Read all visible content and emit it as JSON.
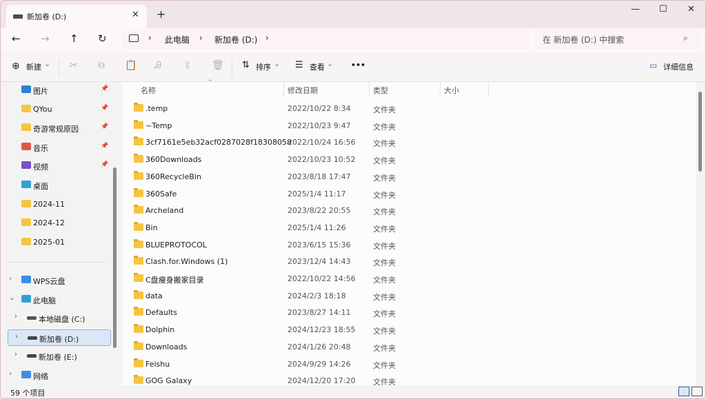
{
  "tab": {
    "title": "新加卷 (D:)",
    "close": "✕",
    "new_tab": "+"
  },
  "window_controls": {
    "minimize": "—",
    "maximize": "☐",
    "close": "✕"
  },
  "nav": {
    "back": "←",
    "forward": "→",
    "up": "↑",
    "refresh": "↻"
  },
  "address": {
    "separator": "›",
    "crumbs": [
      "此电脑",
      "新加卷 (D:)"
    ]
  },
  "search": {
    "placeholder": "在 新加卷 (D:) 中搜索",
    "icon": "⌕"
  },
  "toolbar": {
    "new_label": "新建",
    "new_icon": "⊕",
    "cut_icon": "✂",
    "copy_icon": "⧉",
    "paste_icon": "📋",
    "rename_icon": "Ꭿ",
    "share_icon": "⇪",
    "delete_icon": "🗑",
    "sort_label": "排序",
    "view_label": "查看",
    "more": "•••",
    "details_label": "详细信息",
    "caret": "⌄"
  },
  "sidebar": {
    "pin": "📌",
    "quick_access": [
      {
        "label": "图片",
        "icon": "pictures-icon",
        "color": "#2f7fd6",
        "pinned": true
      },
      {
        "label": "QYou",
        "icon": "folder-icon",
        "color": "#f5c542",
        "pinned": true
      },
      {
        "label": "奇游常规原因",
        "icon": "folder-icon",
        "color": "#f5c542",
        "pinned": true
      },
      {
        "label": "音乐",
        "icon": "music-icon",
        "color": "#e2574c",
        "pinned": true
      },
      {
        "label": "视频",
        "icon": "video-icon",
        "color": "#7b4fc9",
        "pinned": true
      },
      {
        "label": "桌面",
        "icon": "desktop-icon",
        "color": "#2fa0d6",
        "pinned": false
      },
      {
        "label": "2024-11",
        "icon": "folder-icon",
        "color": "#f5c542",
        "pinned": false
      },
      {
        "label": "2024-12",
        "icon": "folder-icon",
        "color": "#f5c542",
        "pinned": false
      },
      {
        "label": "2025-01",
        "icon": "folder-icon",
        "color": "#f5c542",
        "pinned": false
      }
    ],
    "tree": [
      {
        "label": "WPS云盘",
        "icon": "cloud-icon",
        "chevron": "›",
        "indent": 0
      },
      {
        "label": "此电脑",
        "icon": "computer-icon",
        "chevron": "⌄",
        "indent": 0
      },
      {
        "label": "本地磁盘 (C:)",
        "icon": "drive-c-icon",
        "chevron": "›",
        "indent": 1
      },
      {
        "label": "新加卷 (D:)",
        "icon": "drive-icon",
        "chevron": "›",
        "indent": 1,
        "selected": true
      },
      {
        "label": "新加卷 (E:)",
        "icon": "drive-icon",
        "chevron": "›",
        "indent": 1
      },
      {
        "label": "网络",
        "icon": "network-icon",
        "chevron": "›",
        "indent": 0
      }
    ]
  },
  "columns": {
    "name": "名称",
    "modified": "修改日期",
    "type": "类型",
    "size": "大小",
    "sort_indicator": "⌃"
  },
  "files": [
    {
      "name": ".temp",
      "modified": "2022/10/22 8:34",
      "type": "文件夹"
    },
    {
      "name": "~Temp",
      "modified": "2022/10/23 9:47",
      "type": "文件夹"
    },
    {
      "name": "3cf7161e5eb32acf0287028f18308058",
      "modified": "2022/10/24 16:56",
      "type": "文件夹"
    },
    {
      "name": "360Downloads",
      "modified": "2022/10/23 10:52",
      "type": "文件夹"
    },
    {
      "name": "360RecycleBin",
      "modified": "2023/8/18 17:47",
      "type": "文件夹"
    },
    {
      "name": "360Safe",
      "modified": "2025/1/4 11:17",
      "type": "文件夹"
    },
    {
      "name": "Archeland",
      "modified": "2023/8/22 20:55",
      "type": "文件夹"
    },
    {
      "name": "Bin",
      "modified": "2025/1/4 11:26",
      "type": "文件夹"
    },
    {
      "name": "BLUEPROTOCOL",
      "modified": "2023/6/15 15:36",
      "type": "文件夹"
    },
    {
      "name": "Clash.for.Windows (1)",
      "modified": "2023/12/4 14:43",
      "type": "文件夹"
    },
    {
      "name": "C盘瘦身搬家目录",
      "modified": "2022/10/22 14:56",
      "type": "文件夹"
    },
    {
      "name": "data",
      "modified": "2024/2/3 18:18",
      "type": "文件夹"
    },
    {
      "name": "Defaults",
      "modified": "2023/8/27 14:11",
      "type": "文件夹"
    },
    {
      "name": "Dolphin",
      "modified": "2024/12/23 18:55",
      "type": "文件夹"
    },
    {
      "name": "Downloads",
      "modified": "2024/1/26 20:48",
      "type": "文件夹"
    },
    {
      "name": "Feishu",
      "modified": "2024/9/29 14:26",
      "type": "文件夹"
    },
    {
      "name": "GOG Galaxy",
      "modified": "2024/12/20 17:20",
      "type": "文件夹"
    }
  ],
  "status": {
    "item_count": "59 个项目"
  }
}
